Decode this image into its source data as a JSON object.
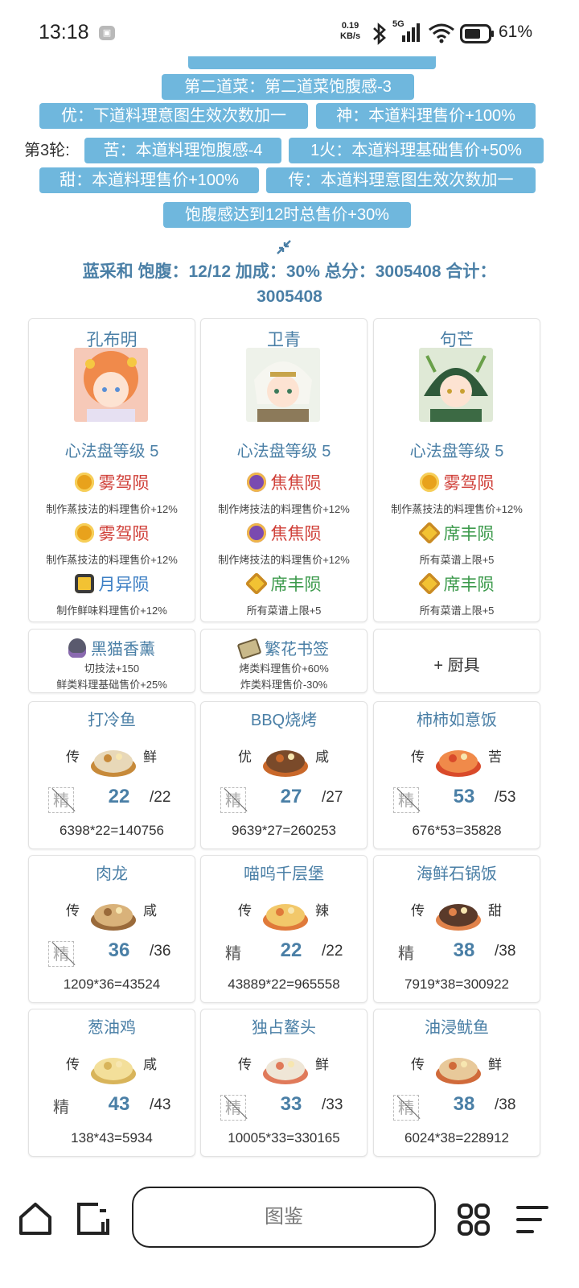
{
  "status_bar": {
    "time": "13:18",
    "notification_icon": "gallery-notification-icon",
    "net_speed_value": "0.19",
    "net_speed_unit": "KB/s",
    "network": "5G",
    "battery": "61%"
  },
  "tags": {
    "row1": [
      "第二道菜：第二道菜饱腹感-3"
    ],
    "row2": [
      "优：下道料理意图生效次数加一",
      "神：本道料理售价+100%"
    ],
    "round_label": "第3轮:",
    "row3": [
      "苦：本道料理饱腹感-4",
      "1火：本道料理基础售价+50%"
    ],
    "row4": [
      "甜：本道料理售价+100%",
      "传：本道料理意图生效次数加一"
    ],
    "row5": [
      "饱腹感达到12时总售价+30%"
    ]
  },
  "summary": {
    "line1": "蓝采和 饱腹：12/12 加成：30% 总分：3005408 合计：",
    "line2": "3005408"
  },
  "chefs": [
    {
      "name": "孔布明",
      "level": "心法盘等级 5",
      "skills": [
        {
          "name": "雾驾陨",
          "desc": "制作蒸技法的料理售价+12%",
          "icon": "gold-coin-icon",
          "color": "#d0413a"
        },
        {
          "name": "雾驾陨",
          "desc": "制作蒸技法的料理售价+12%",
          "icon": "gold-coin-icon",
          "color": "#d0413a"
        },
        {
          "name": "月异陨",
          "desc": "制作鲜味料理售价+12%",
          "icon": "gold-square-icon",
          "color": "#3d7fc4"
        }
      ]
    },
    {
      "name": "卫青",
      "level": "心法盘等级 5",
      "skills": [
        {
          "name": "焦焦陨",
          "desc": "制作烤技法的料理售价+12%",
          "icon": "purple-coin-icon",
          "color": "#d0413a"
        },
        {
          "name": "焦焦陨",
          "desc": "制作烤技法的料理售价+12%",
          "icon": "purple-coin-icon",
          "color": "#d0413a"
        },
        {
          "name": "席丰陨",
          "desc": "所有菜谱上限+5",
          "icon": "gold-hexagon-icon",
          "color": "#3c9a4c"
        }
      ]
    },
    {
      "name": "句芒",
      "level": "心法盘等级 5",
      "skills": [
        {
          "name": "雾驾陨",
          "desc": "制作蒸技法的料理售价+12%",
          "icon": "gold-coin-icon",
          "color": "#d0413a"
        },
        {
          "name": "席丰陨",
          "desc": "所有菜谱上限+5",
          "icon": "gold-hexagon-icon",
          "color": "#3c9a4c"
        },
        {
          "name": "席丰陨",
          "desc": "所有菜谱上限+5",
          "icon": "gold-hexagon-icon",
          "color": "#3c9a4c"
        }
      ]
    }
  ],
  "equipment": [
    {
      "name": "黑猫香薰",
      "icon": "incense-burner-icon",
      "desc": [
        "切技法+150",
        "鲜类料理基础售价+25%"
      ]
    },
    {
      "name": "繁花书签",
      "icon": "bookmark-icon",
      "desc": [
        "烤类料理售价+60%",
        "炸类料理售价-30%"
      ]
    },
    {
      "add_label": "+ 厨具"
    }
  ],
  "dishes": [
    {
      "name": "打冷鱼",
      "tag_left": "传",
      "tag_right": "鲜",
      "jing": "精",
      "jing_active": false,
      "qty": "22",
      "max": "/22",
      "calc": "6398*22=140756",
      "icon": "fish-dish-icon"
    },
    {
      "name": "BBQ烧烤",
      "tag_left": "优",
      "tag_right": "咸",
      "jing": "精",
      "jing_active": false,
      "qty": "27",
      "max": "/27",
      "calc": "9639*27=260253",
      "icon": "bbq-dish-icon"
    },
    {
      "name": "柿柿如意饭",
      "tag_left": "传",
      "tag_right": "苦",
      "jing": "精",
      "jing_active": false,
      "qty": "53",
      "max": "/53",
      "calc": "676*53=35828",
      "icon": "persimmon-rice-icon"
    },
    {
      "name": "肉龙",
      "tag_left": "传",
      "tag_right": "咸",
      "jing": "精",
      "jing_active": false,
      "qty": "36",
      "max": "/36",
      "calc": "1209*36=43524",
      "icon": "steamer-dish-icon"
    },
    {
      "name": "喵呜千层堡",
      "tag_left": "传",
      "tag_right": "辣",
      "jing": "精",
      "jing_active": true,
      "qty": "22",
      "max": "/22",
      "calc": "43889*22=965558",
      "icon": "layer-burger-icon"
    },
    {
      "name": "海鲜石锅饭",
      "tag_left": "传",
      "tag_right": "甜",
      "jing": "精",
      "jing_active": true,
      "qty": "38",
      "max": "/38",
      "calc": "7919*38=300922",
      "icon": "stone-pot-rice-icon"
    },
    {
      "name": "葱油鸡",
      "tag_left": "传",
      "tag_right": "咸",
      "jing": "精",
      "jing_active": true,
      "qty": "43",
      "max": "/43",
      "calc": "138*43=5934",
      "icon": "scallion-chicken-icon"
    },
    {
      "name": "独占鳌头",
      "tag_left": "传",
      "tag_right": "鲜",
      "jing": "精",
      "jing_active": false,
      "qty": "33",
      "max": "/33",
      "calc": "10005*33=330165",
      "icon": "shell-dish-icon"
    },
    {
      "name": "油浸鱿鱼",
      "tag_left": "传",
      "tag_right": "鲜",
      "jing": "精",
      "jing_active": false,
      "qty": "38",
      "max": "/38",
      "calc": "6024*38=228912",
      "icon": "squid-dish-icon"
    }
  ],
  "bottom_nav": {
    "search_label": "图鉴",
    "icons": [
      "home-icon",
      "tabs-icon",
      "apps-grid-icon",
      "menu-icon"
    ]
  }
}
